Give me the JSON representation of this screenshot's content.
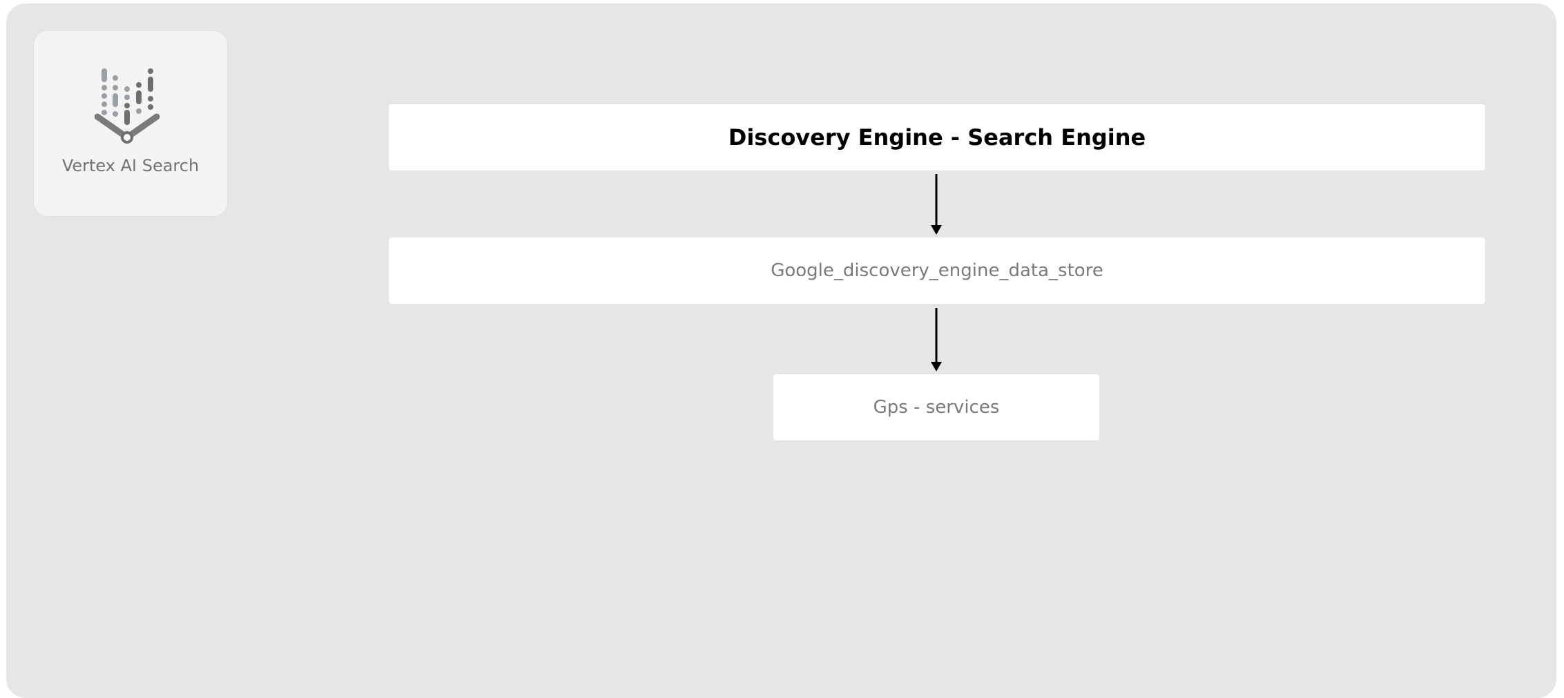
{
  "service": {
    "label": "Vertex AI Search",
    "icon": "vertex-ai-search-icon"
  },
  "nodes": {
    "engine": "Discovery Engine - Search Engine",
    "data_store": "Google_discovery_engine_data_store",
    "services": "Gps - services"
  },
  "edges": [
    {
      "from": "Discovery Engine - Search Engine",
      "to": "Google_discovery_engine_data_store"
    },
    {
      "from": "Google_discovery_engine_data_store",
      "to": "Gps - services"
    }
  ],
  "colors": {
    "background": "#e6e6e6",
    "node": "#ffffff",
    "edge": "#000000",
    "muted_text": "#7a7a7a",
    "icon_dark": "#5f6368",
    "icon_light": "#9aa0a6"
  }
}
